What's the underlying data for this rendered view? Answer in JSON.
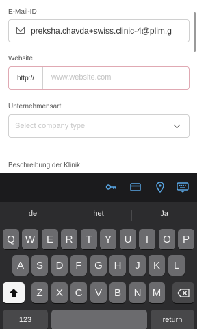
{
  "form": {
    "email": {
      "label": "E-Mail-ID",
      "value": "preksha.chavda+swiss.clinic-4@plim.g"
    },
    "website": {
      "label": "Website",
      "prefix": "http://",
      "placeholder": "www.website.com"
    },
    "company_type": {
      "label": "Unternehmensart",
      "placeholder": "Select company type"
    },
    "description": {
      "label": "Beschreibung der Klinik"
    }
  },
  "keyboard": {
    "toolbar_icons": [
      "key-icon",
      "credit-card-icon",
      "location-pin-icon",
      "keyboard-icon"
    ],
    "suggestions": [
      "de",
      "het",
      "Ja"
    ],
    "rows": [
      [
        "Q",
        "W",
        "E",
        "R",
        "T",
        "Y",
        "U",
        "I",
        "O",
        "P"
      ],
      [
        "A",
        "S",
        "D",
        "F",
        "G",
        "H",
        "J",
        "K",
        "L"
      ],
      [
        "Z",
        "X",
        "C",
        "V",
        "B",
        "N",
        "M"
      ]
    ],
    "numbers_label": "123",
    "return_label": "return"
  },
  "colors": {
    "accent": "#e0a9b3",
    "keyboard_bg": "#2c2c2e",
    "toolbar_icon": "#5aa8e6"
  }
}
